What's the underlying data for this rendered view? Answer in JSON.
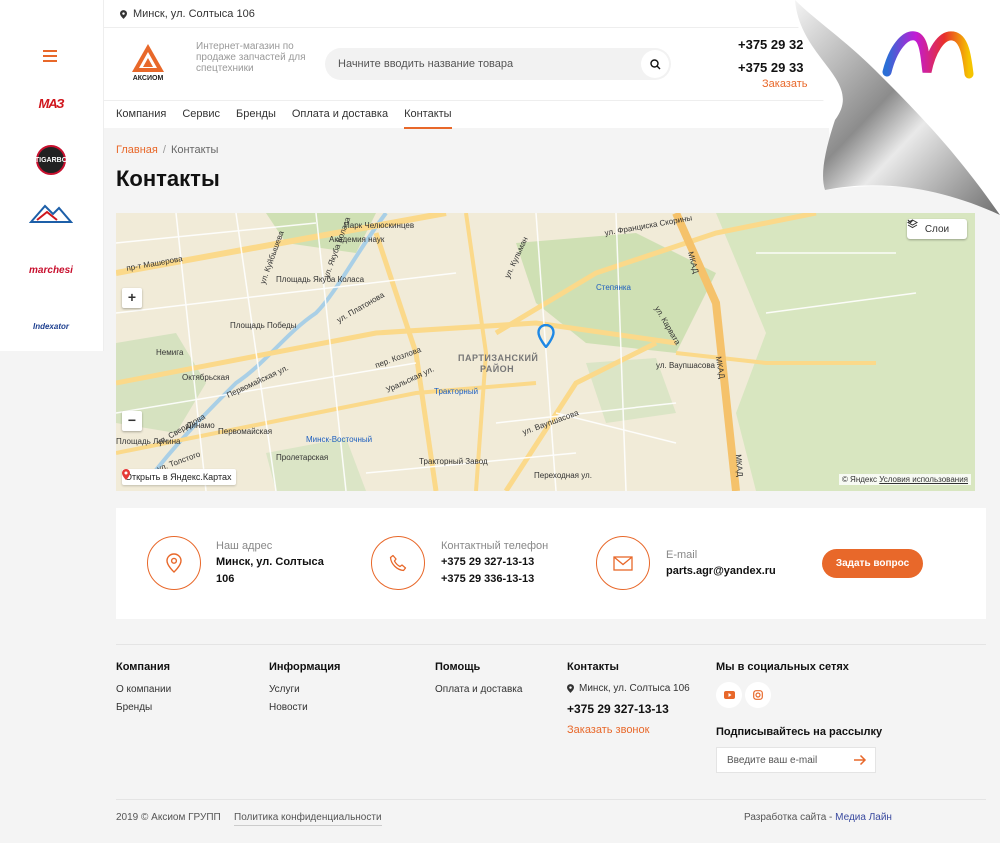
{
  "topbar": {
    "address": "Минск, ул. Солтыса 106"
  },
  "header": {
    "tagline": "Интернет-магазин по продаже запчастей для спецтехники",
    "logo_text": "АКСИОМ",
    "search_placeholder": "Начните вводить название товара",
    "phone1": "+375 29 32",
    "phone2": "+375 29 33",
    "callback": "Заказать"
  },
  "nav": {
    "items": [
      {
        "label": "Компания"
      },
      {
        "label": "Сервис"
      },
      {
        "label": "Бренды"
      },
      {
        "label": "Оплата и доставка"
      },
      {
        "label": "Контакты",
        "active": true
      }
    ]
  },
  "brands": [
    "МАЗ",
    "TIGARBO",
    "marchesi",
    "Indexator"
  ],
  "breadcrumb": {
    "home": "Главная",
    "sep": "/",
    "current": "Контакты"
  },
  "page_title": "Контакты",
  "map": {
    "layers": "Слои",
    "open_yandex": "Открыть в Яндекс.Картах",
    "copyright": "© Яндекс",
    "terms": "Условия использования",
    "labels": {
      "park": "Парк Челюскинцев",
      "academy": "Академия наук",
      "kolas": "ул. Якуба Коласа",
      "kolas_sq": "Площадь Якуба Коласа",
      "pobedy": "Площадь Победы",
      "nemiga": "Немига",
      "oktyabr": "Октябрьская",
      "lenina": "Площадь Ленина",
      "dinamo": "Динамо",
      "pervomay": "Первомайская",
      "proletar": "Пролетарская",
      "vostochny": "Минск-Восточный",
      "traktorny": "Тракторный",
      "traktorny_zavod": "Тракторный Завод",
      "partizansky": "ПАРТИЗАНСКИЙ",
      "rayon": "РАЙОН",
      "stepyanka": "Степянка",
      "vaushasova": "ул. Ваупшасова",
      "vaushasova2": "ул. Ваупшасова",
      "mkad1": "МКАД",
      "mkad2": "МКАД",
      "mkad3": "МКАД",
      "skoriny": "ул. Франциска Скорины",
      "platonova": "ул. Платонова",
      "kozlova": "пер. Козлова",
      "uralskaya": "Уральская ул.",
      "perehodnaya": "Переходная ул.",
      "karvata": "ул. Карвата",
      "mashero": "пр-т Машерова",
      "kuibysheva": "ул. Куйбышева",
      "sverdlova": "ул. Свердлова",
      "tolstogo": "ул. Толстого",
      "pervomayskaya": "Первомайская ул.",
      "puteplan": "ул. Кульман"
    }
  },
  "contacts": {
    "address_label": "Наш адрес",
    "address_value1": "Минск, ул. Солтыса",
    "address_value2": "106",
    "phone_label": "Контактный телефон",
    "phone1": "+375 29 327-13-13",
    "phone2": "+375 29 336-13-13",
    "email_label": "E-mail",
    "email": "parts.agr@yandex.ru",
    "ask_button": "Задать вопрос"
  },
  "footer": {
    "col1": {
      "title": "Компания",
      "links": [
        "О компании",
        "Бренды"
      ]
    },
    "col2": {
      "title": "Информация",
      "links": [
        "Услуги",
        "Новости"
      ]
    },
    "col3": {
      "title": "Помощь",
      "links": [
        "Оплата и доставка"
      ]
    },
    "col4": {
      "title": "Контакты",
      "address": "Минск, ул. Солтыса 106",
      "phone": "+375 29 327-13-13",
      "callback": "Заказать звонок"
    },
    "col5": {
      "title": "Мы в социальных сетях",
      "subscribe_title": "Подписывайтесь на рассылку",
      "email_placeholder": "Введите ваш e-mail"
    },
    "copyright": "2019 © Аксиом ГРУПП",
    "policy": "Политика конфиденциальности",
    "dev_prefix": "Разработка сайта - ",
    "dev_link": "Медиа Лайн"
  },
  "colors": {
    "accent": "#e8682a",
    "map_bg": "#f1ebd8",
    "park": "#cfe0b4",
    "road": "#fbd98a"
  }
}
